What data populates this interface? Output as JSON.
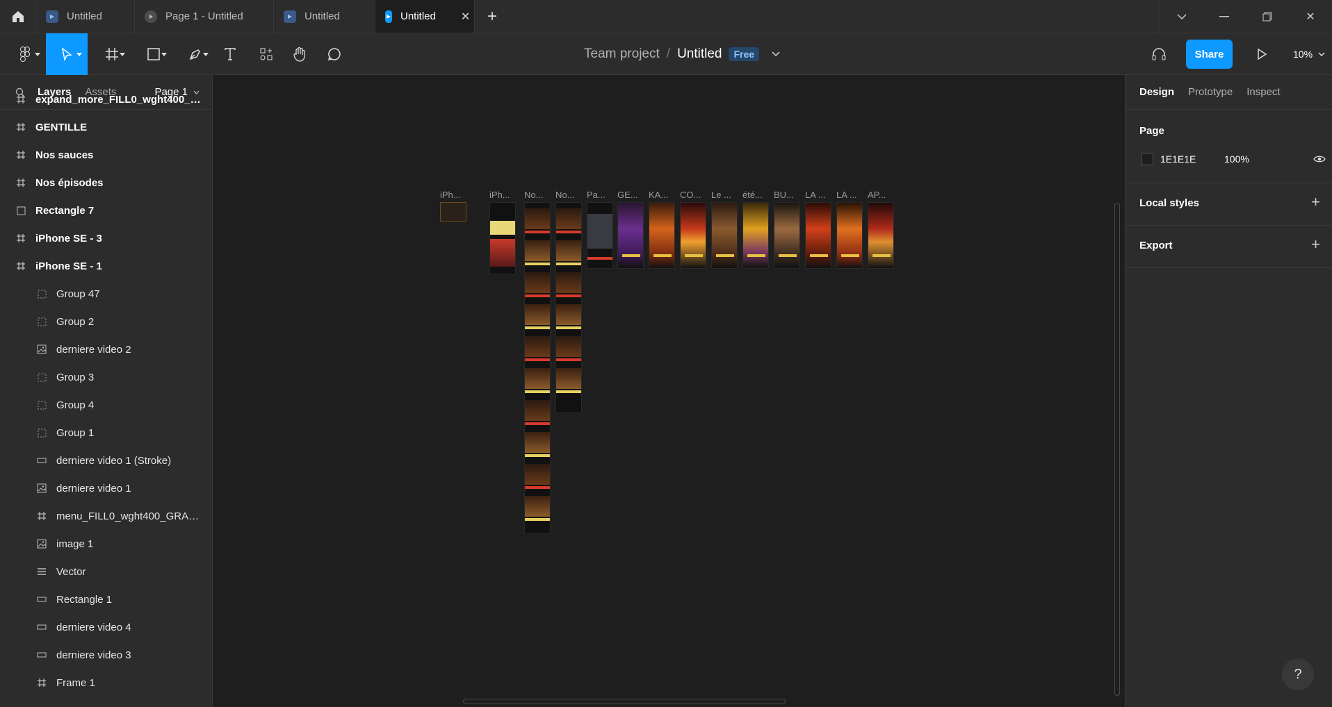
{
  "tabs": [
    {
      "label": "Untitled",
      "icon": "figma-file-icon"
    },
    {
      "label": "Page 1 - Untitled",
      "icon": "prototype-play-icon"
    },
    {
      "label": "Untitled",
      "icon": "figma-file-icon"
    },
    {
      "label": "Untitled",
      "icon": "figma-file-icon",
      "active": true
    }
  ],
  "toolbar": {
    "project": "Team project",
    "separator": "/",
    "file_name": "Untitled",
    "plan_badge": "Free",
    "share_label": "Share",
    "zoom": "10%"
  },
  "left_panel": {
    "tab_layers": "Layers",
    "tab_assets": "Assets",
    "page": "Page 1",
    "layers": [
      {
        "name": "expand_more_FILL0_wght400_GR...",
        "icon": "frame-icon",
        "level": 0
      },
      {
        "name": "GENTILLE",
        "icon": "frame-icon",
        "level": 0
      },
      {
        "name": "Nos sauces",
        "icon": "frame-icon",
        "level": 0
      },
      {
        "name": "Nos épisodes",
        "icon": "frame-icon",
        "level": 0
      },
      {
        "name": "Rectangle 7",
        "icon": "rectangle-icon",
        "level": 0
      },
      {
        "name": "iPhone SE - 3",
        "icon": "frame-icon",
        "level": 0
      },
      {
        "name": "iPhone SE - 1",
        "icon": "frame-icon",
        "level": 0
      },
      {
        "name": "Group 47",
        "icon": "group-icon",
        "level": 1
      },
      {
        "name": "Group 2",
        "icon": "group-icon",
        "level": 1
      },
      {
        "name": "derniere video 2",
        "icon": "image-icon",
        "level": 1
      },
      {
        "name": "Group 3",
        "icon": "group-icon",
        "level": 1
      },
      {
        "name": "Group 4",
        "icon": "group-icon",
        "level": 1
      },
      {
        "name": "Group 1",
        "icon": "group-icon",
        "level": 1
      },
      {
        "name": "derniere video 1 (Stroke)",
        "icon": "stroke-icon",
        "level": 1
      },
      {
        "name": "derniere video 1",
        "icon": "image-icon",
        "level": 1
      },
      {
        "name": "menu_FILL0_wght400_GRAD0_...",
        "icon": "frame-icon",
        "level": 1
      },
      {
        "name": "image 1",
        "icon": "image-icon",
        "level": 1
      },
      {
        "name": "Vector",
        "icon": "vector-icon",
        "level": 1
      },
      {
        "name": "Rectangle 1",
        "icon": "stroke-icon",
        "level": 1
      },
      {
        "name": "derniere video 4",
        "icon": "stroke-icon",
        "level": 1
      },
      {
        "name": "derniere video 3",
        "icon": "stroke-icon",
        "level": 1
      },
      {
        "name": "Frame 1",
        "icon": "frame-icon",
        "level": 1
      }
    ]
  },
  "canvas": {
    "frame_labels": [
      "iPh...",
      "iPh...",
      "No...",
      "No...",
      "Pa...",
      "GE...",
      "KA...",
      "CO...",
      "Le ...",
      "été...",
      "BU...",
      "LA ...",
      "LA ...",
      "AP..."
    ]
  },
  "right_panel": {
    "tab_design": "Design",
    "tab_prototype": "Prototype",
    "tab_inspect": "Inspect",
    "page_title": "Page",
    "page_color": "1E1E1E",
    "page_opacity": "100%",
    "local_styles": "Local styles",
    "export": "Export"
  },
  "help": "?"
}
